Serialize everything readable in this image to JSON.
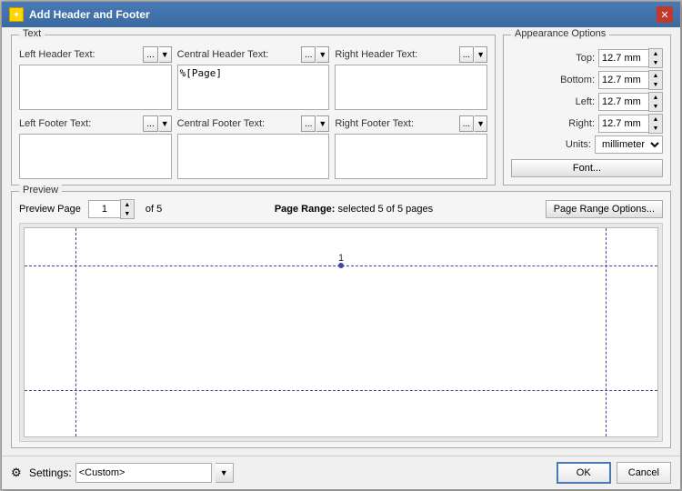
{
  "dialog": {
    "title": "Add Header and Footer",
    "icon": "✦"
  },
  "text_section": {
    "label": "Text",
    "left_header": {
      "label": "Left Header Text:",
      "value": "",
      "insert_label": "..."
    },
    "central_header": {
      "label": "Central Header Text:",
      "value": "%[Page]",
      "insert_label": "..."
    },
    "right_header": {
      "label": "Right Header Text:",
      "value": "",
      "insert_label": "..."
    },
    "left_footer": {
      "label": "Left Footer Text:",
      "value": "",
      "insert_label": "..."
    },
    "central_footer": {
      "label": "Central Footer Text:",
      "value": "",
      "insert_label": "..."
    },
    "right_footer": {
      "label": "Right Footer Text:",
      "value": "",
      "insert_label": "..."
    }
  },
  "appearance": {
    "label": "Appearance Options",
    "top_label": "Top:",
    "top_value": "12.7 mm",
    "bottom_label": "Bottom:",
    "bottom_value": "12.7 mm",
    "left_label": "Left:",
    "left_value": "12.7 mm",
    "right_label": "Right:",
    "right_value": "12.7 mm",
    "units_label": "Units:",
    "units_value": "millimeter",
    "font_button": "Font..."
  },
  "preview": {
    "label": "Preview",
    "page_label": "Preview Page",
    "page_value": "1",
    "of_text": "of 5",
    "page_range_label": "Page Range:",
    "page_range_value": "selected 5 of 5 pages",
    "page_range_button": "Page Range Options...",
    "page_number": "1"
  },
  "footer": {
    "settings_icon": "⚙",
    "settings_label": "Settings:",
    "settings_value": "<Custom>",
    "ok_label": "OK",
    "cancel_label": "Cancel"
  }
}
